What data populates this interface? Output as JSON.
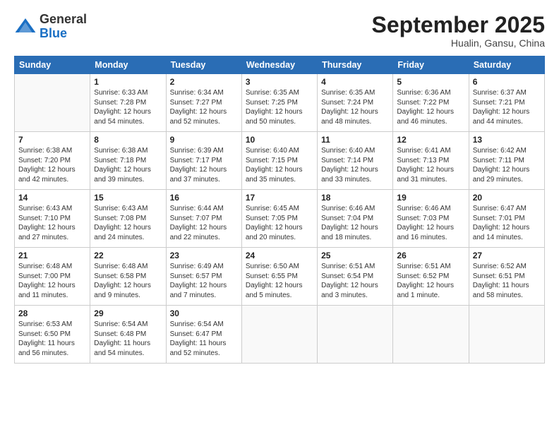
{
  "header": {
    "logo_general": "General",
    "logo_blue": "Blue",
    "month_title": "September 2025",
    "location": "Hualin, Gansu, China"
  },
  "weekdays": [
    "Sunday",
    "Monday",
    "Tuesday",
    "Wednesday",
    "Thursday",
    "Friday",
    "Saturday"
  ],
  "weeks": [
    [
      {
        "day": "",
        "sunrise": "",
        "sunset": "",
        "daylight": ""
      },
      {
        "day": "1",
        "sunrise": "Sunrise: 6:33 AM",
        "sunset": "Sunset: 7:28 PM",
        "daylight": "Daylight: 12 hours and 54 minutes."
      },
      {
        "day": "2",
        "sunrise": "Sunrise: 6:34 AM",
        "sunset": "Sunset: 7:27 PM",
        "daylight": "Daylight: 12 hours and 52 minutes."
      },
      {
        "day": "3",
        "sunrise": "Sunrise: 6:35 AM",
        "sunset": "Sunset: 7:25 PM",
        "daylight": "Daylight: 12 hours and 50 minutes."
      },
      {
        "day": "4",
        "sunrise": "Sunrise: 6:35 AM",
        "sunset": "Sunset: 7:24 PM",
        "daylight": "Daylight: 12 hours and 48 minutes."
      },
      {
        "day": "5",
        "sunrise": "Sunrise: 6:36 AM",
        "sunset": "Sunset: 7:22 PM",
        "daylight": "Daylight: 12 hours and 46 minutes."
      },
      {
        "day": "6",
        "sunrise": "Sunrise: 6:37 AM",
        "sunset": "Sunset: 7:21 PM",
        "daylight": "Daylight: 12 hours and 44 minutes."
      }
    ],
    [
      {
        "day": "7",
        "sunrise": "Sunrise: 6:38 AM",
        "sunset": "Sunset: 7:20 PM",
        "daylight": "Daylight: 12 hours and 42 minutes."
      },
      {
        "day": "8",
        "sunrise": "Sunrise: 6:38 AM",
        "sunset": "Sunset: 7:18 PM",
        "daylight": "Daylight: 12 hours and 39 minutes."
      },
      {
        "day": "9",
        "sunrise": "Sunrise: 6:39 AM",
        "sunset": "Sunset: 7:17 PM",
        "daylight": "Daylight: 12 hours and 37 minutes."
      },
      {
        "day": "10",
        "sunrise": "Sunrise: 6:40 AM",
        "sunset": "Sunset: 7:15 PM",
        "daylight": "Daylight: 12 hours and 35 minutes."
      },
      {
        "day": "11",
        "sunrise": "Sunrise: 6:40 AM",
        "sunset": "Sunset: 7:14 PM",
        "daylight": "Daylight: 12 hours and 33 minutes."
      },
      {
        "day": "12",
        "sunrise": "Sunrise: 6:41 AM",
        "sunset": "Sunset: 7:13 PM",
        "daylight": "Daylight: 12 hours and 31 minutes."
      },
      {
        "day": "13",
        "sunrise": "Sunrise: 6:42 AM",
        "sunset": "Sunset: 7:11 PM",
        "daylight": "Daylight: 12 hours and 29 minutes."
      }
    ],
    [
      {
        "day": "14",
        "sunrise": "Sunrise: 6:43 AM",
        "sunset": "Sunset: 7:10 PM",
        "daylight": "Daylight: 12 hours and 27 minutes."
      },
      {
        "day": "15",
        "sunrise": "Sunrise: 6:43 AM",
        "sunset": "Sunset: 7:08 PM",
        "daylight": "Daylight: 12 hours and 24 minutes."
      },
      {
        "day": "16",
        "sunrise": "Sunrise: 6:44 AM",
        "sunset": "Sunset: 7:07 PM",
        "daylight": "Daylight: 12 hours and 22 minutes."
      },
      {
        "day": "17",
        "sunrise": "Sunrise: 6:45 AM",
        "sunset": "Sunset: 7:05 PM",
        "daylight": "Daylight: 12 hours and 20 minutes."
      },
      {
        "day": "18",
        "sunrise": "Sunrise: 6:46 AM",
        "sunset": "Sunset: 7:04 PM",
        "daylight": "Daylight: 12 hours and 18 minutes."
      },
      {
        "day": "19",
        "sunrise": "Sunrise: 6:46 AM",
        "sunset": "Sunset: 7:03 PM",
        "daylight": "Daylight: 12 hours and 16 minutes."
      },
      {
        "day": "20",
        "sunrise": "Sunrise: 6:47 AM",
        "sunset": "Sunset: 7:01 PM",
        "daylight": "Daylight: 12 hours and 14 minutes."
      }
    ],
    [
      {
        "day": "21",
        "sunrise": "Sunrise: 6:48 AM",
        "sunset": "Sunset: 7:00 PM",
        "daylight": "Daylight: 12 hours and 11 minutes."
      },
      {
        "day": "22",
        "sunrise": "Sunrise: 6:48 AM",
        "sunset": "Sunset: 6:58 PM",
        "daylight": "Daylight: 12 hours and 9 minutes."
      },
      {
        "day": "23",
        "sunrise": "Sunrise: 6:49 AM",
        "sunset": "Sunset: 6:57 PM",
        "daylight": "Daylight: 12 hours and 7 minutes."
      },
      {
        "day": "24",
        "sunrise": "Sunrise: 6:50 AM",
        "sunset": "Sunset: 6:55 PM",
        "daylight": "Daylight: 12 hours and 5 minutes."
      },
      {
        "day": "25",
        "sunrise": "Sunrise: 6:51 AM",
        "sunset": "Sunset: 6:54 PM",
        "daylight": "Daylight: 12 hours and 3 minutes."
      },
      {
        "day": "26",
        "sunrise": "Sunrise: 6:51 AM",
        "sunset": "Sunset: 6:52 PM",
        "daylight": "Daylight: 12 hours and 1 minute."
      },
      {
        "day": "27",
        "sunrise": "Sunrise: 6:52 AM",
        "sunset": "Sunset: 6:51 PM",
        "daylight": "Daylight: 11 hours and 58 minutes."
      }
    ],
    [
      {
        "day": "28",
        "sunrise": "Sunrise: 6:53 AM",
        "sunset": "Sunset: 6:50 PM",
        "daylight": "Daylight: 11 hours and 56 minutes."
      },
      {
        "day": "29",
        "sunrise": "Sunrise: 6:54 AM",
        "sunset": "Sunset: 6:48 PM",
        "daylight": "Daylight: 11 hours and 54 minutes."
      },
      {
        "day": "30",
        "sunrise": "Sunrise: 6:54 AM",
        "sunset": "Sunset: 6:47 PM",
        "daylight": "Daylight: 11 hours and 52 minutes."
      },
      {
        "day": "",
        "sunrise": "",
        "sunset": "",
        "daylight": ""
      },
      {
        "day": "",
        "sunrise": "",
        "sunset": "",
        "daylight": ""
      },
      {
        "day": "",
        "sunrise": "",
        "sunset": "",
        "daylight": ""
      },
      {
        "day": "",
        "sunrise": "",
        "sunset": "",
        "daylight": ""
      }
    ]
  ]
}
